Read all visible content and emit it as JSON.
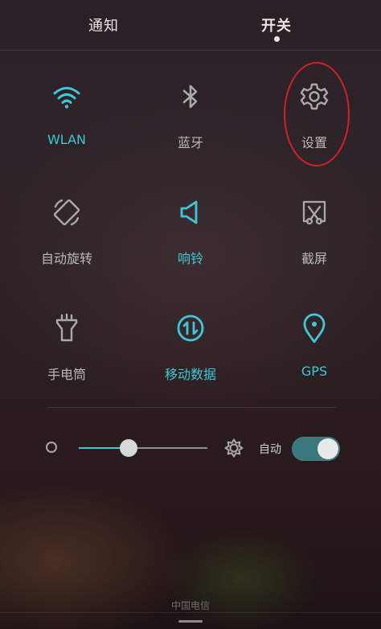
{
  "tabs": {
    "notify_label": "通知",
    "switch_label": "开关",
    "active": "开关"
  },
  "tiles": [
    {
      "label": "WLAN",
      "icon": "wifi-icon",
      "active": true
    },
    {
      "label": "蓝牙",
      "icon": "bluetooth-icon",
      "active": false
    },
    {
      "label": "设置",
      "icon": "gear-icon",
      "active": false
    },
    {
      "label": "自动旋转",
      "icon": "auto-rotate-icon",
      "active": false
    },
    {
      "label": "响铃",
      "icon": "speaker-icon",
      "active": true
    },
    {
      "label": "截屏",
      "icon": "screenshot-icon",
      "active": false
    },
    {
      "label": "手电筒",
      "icon": "flashlight-icon",
      "active": false
    },
    {
      "label": "移动数据",
      "icon": "mobile-data-icon",
      "active": true
    },
    {
      "label": "GPS",
      "icon": "location-pin-icon",
      "active": true
    }
  ],
  "brightness": {
    "level": 0.39,
    "low_icon": "brightness-low-icon",
    "high_icon": "sun-icon",
    "auto_label": "自动",
    "auto_enabled": true
  },
  "status": {
    "carrier": "中国电信"
  },
  "colors": {
    "accent": "#3fc7d8",
    "inactive": "#b9b9b9",
    "annotation": "#d2202a"
  }
}
